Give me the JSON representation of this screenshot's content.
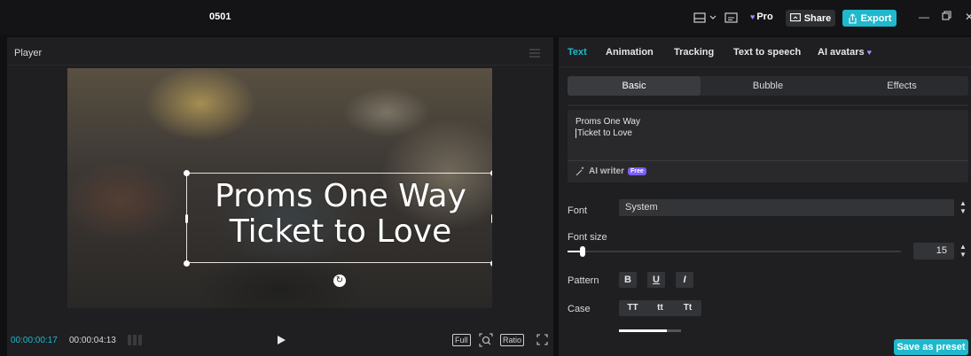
{
  "titlebar": {
    "project_title": "0501",
    "pro_label": "Pro",
    "share_label": "Share",
    "export_label": "Export"
  },
  "player": {
    "title": "Player",
    "caption_line1": "Proms One Way",
    "caption_line2": "Ticket to Love",
    "time_current": "00:00:00:17",
    "time_total": "00:00:04:13",
    "full_label": "Full",
    "ratio_label": "Ratio"
  },
  "panel": {
    "tabs": [
      {
        "label": "Text",
        "active": true
      },
      {
        "label": "Animation"
      },
      {
        "label": "Tracking"
      },
      {
        "label": "Text to speech"
      },
      {
        "label": "AI avatars"
      }
    ],
    "subtabs": [
      {
        "label": "Basic",
        "active": true
      },
      {
        "label": "Bubble"
      },
      {
        "label": "Effects"
      }
    ],
    "text_input": {
      "line1": "Proms One Way",
      "line2": "Ticket to Love"
    },
    "ai_writer_label": "AI writer",
    "free_badge": "Free",
    "font": {
      "label": "Font",
      "value": "System"
    },
    "font_size": {
      "label": "Font size",
      "value": "15",
      "slider_fraction": 0.045
    },
    "pattern": {
      "label": "Pattern",
      "bold": "B",
      "underline": "U",
      "italic": "I"
    },
    "case": {
      "label": "Case",
      "upper": "TT",
      "lower": "tt",
      "title": "Tt"
    },
    "save_preset_label": "Save as preset"
  },
  "colors": {
    "accent": "#1fb8cd",
    "purple": "#a58bff",
    "panel_bg": "#1f1f21"
  }
}
